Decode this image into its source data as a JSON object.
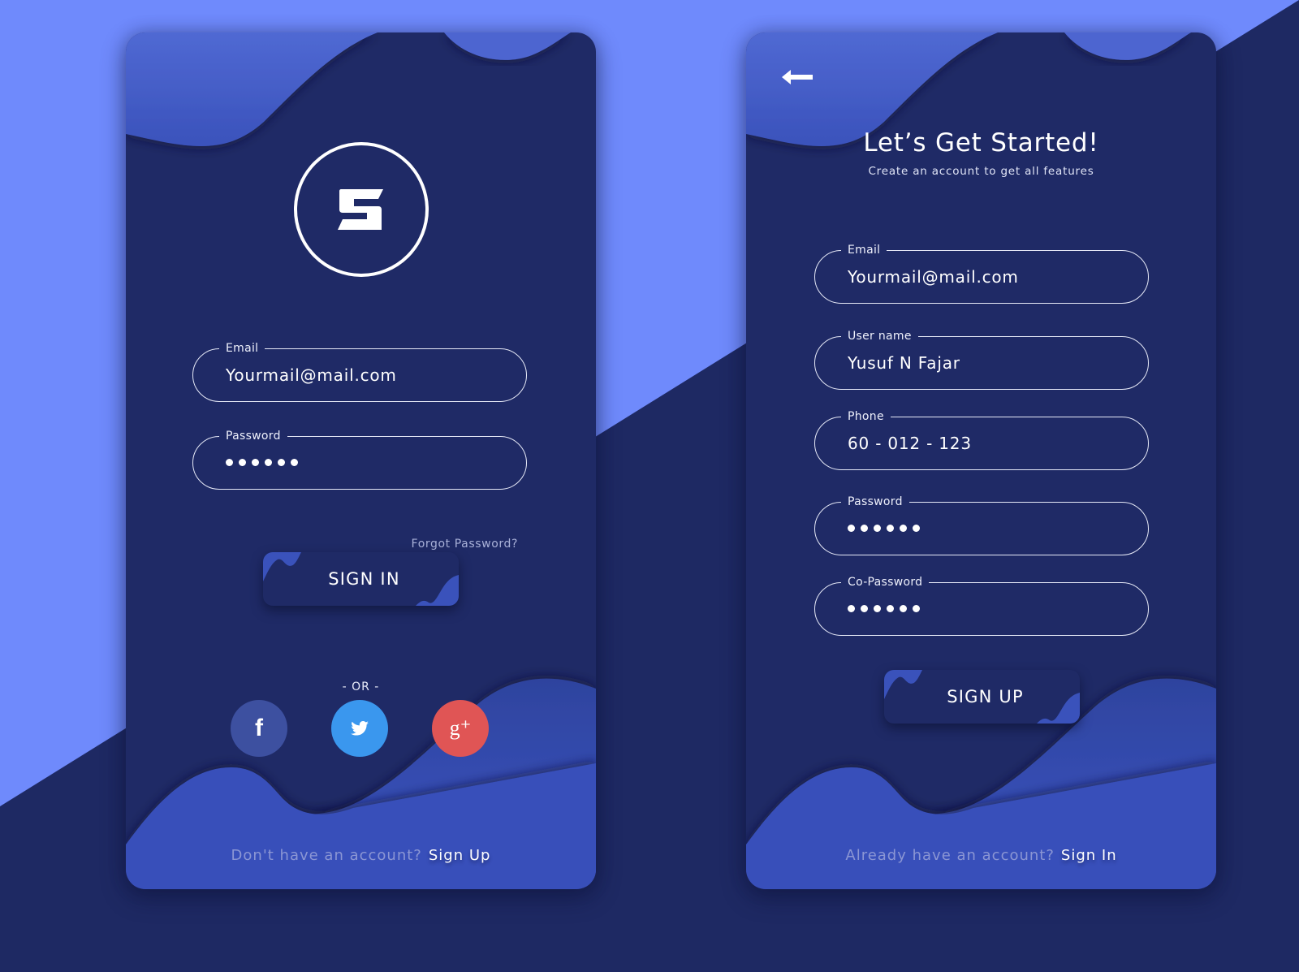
{
  "colors": {
    "background_dark": "#1e2963",
    "background_light": "#6f8afc",
    "card": "#1f2a66",
    "wave": "#3a52bd",
    "facebook": "#3d50a0",
    "twitter": "#3a97ee",
    "google_plus": "#e05555",
    "muted_text": "#8b96d4"
  },
  "sign_in": {
    "logo": {
      "icon": "s-logo-icon",
      "letter": "S"
    },
    "fields": [
      {
        "label": "Email",
        "value": "Yourmail@mail.com",
        "type": "text"
      },
      {
        "label": "Password",
        "value": "••••••",
        "type": "password",
        "masked_length": 6
      }
    ],
    "forgot_password": "Forgot Password?",
    "submit_label": "SIGN IN",
    "divider": "- OR -",
    "social": [
      {
        "name": "facebook",
        "glyph": "f"
      },
      {
        "name": "twitter",
        "glyph": "twitter-bird"
      },
      {
        "name": "google-plus",
        "glyph": "g⁺"
      }
    ],
    "footer_prompt": "Don't have an account?",
    "footer_link": "Sign Up"
  },
  "sign_up": {
    "back_icon": "arrow-left-icon",
    "title": "Let’s Get Started!",
    "subtitle": "Create an account to get all features",
    "fields": [
      {
        "label": "Email",
        "value": "Yourmail@mail.com",
        "type": "text"
      },
      {
        "label": "User name",
        "value": "Yusuf N Fajar",
        "type": "text"
      },
      {
        "label": "Phone",
        "value": "60 - 012 - 123",
        "type": "text"
      },
      {
        "label": "Password",
        "value": "••••••",
        "type": "password",
        "masked_length": 6
      },
      {
        "label": "Co-Password",
        "value": "••••••",
        "type": "password",
        "masked_length": 6
      }
    ],
    "submit_label": "SIGN UP",
    "footer_prompt": "Already have an account?",
    "footer_link": "Sign In"
  }
}
